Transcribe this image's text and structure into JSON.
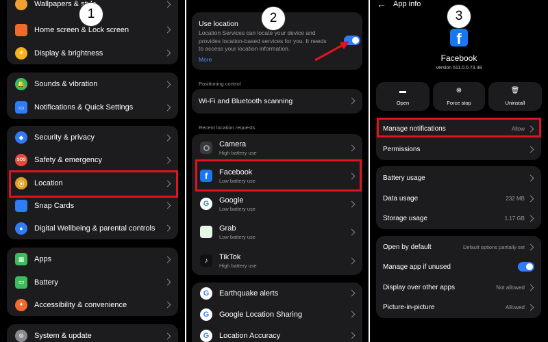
{
  "panel1": {
    "badge": "1",
    "items": [
      {
        "label": "Wallpapers & style",
        "color": "#f0a030"
      },
      {
        "label": "Home screen & Lock screen",
        "color": "#f06a2e"
      },
      {
        "label": "Display & brightness",
        "color": "#f6b21a"
      },
      {
        "label": "Sounds & vibration",
        "color": "#3cbc5a"
      },
      {
        "label": "Notifications & Quick Settings",
        "color": "#2f7cf6"
      },
      {
        "label": "Security & privacy",
        "color": "#2f7cf6"
      },
      {
        "label": "Safety & emergency",
        "color": "#e84a3c",
        "icon_text": "SOS"
      },
      {
        "label": "Location",
        "color": "#e0a020"
      },
      {
        "label": "Snap Cards",
        "color": "#2f7cf6"
      },
      {
        "label": "Digital Wellbeing & parental controls",
        "color": "#2f7cf6"
      },
      {
        "label": "Apps",
        "color": "#3cbc5a"
      },
      {
        "label": "Battery",
        "color": "#3cbc5a"
      },
      {
        "label": "Accessibility & convenience",
        "color": "#f06a2e"
      },
      {
        "label": "System & update",
        "color": "#8a8a8e"
      }
    ]
  },
  "panel2": {
    "badge": "2",
    "use_location": {
      "title": "Use location",
      "description": "Location Services can locate your device and provides location-based services for you. It needs to access your location information.",
      "more": "More",
      "enabled": true
    },
    "positioning_header": "Positioning control",
    "wifi_bt": "Wi-Fi and Bluetooth scanning",
    "recent_header": "Recent location requests",
    "recent": [
      {
        "name": "Camera",
        "usage": "High battery use"
      },
      {
        "name": "Facebook",
        "usage": "Low battery use"
      },
      {
        "name": "Google",
        "usage": "Low battery use"
      },
      {
        "name": "Grab",
        "usage": "Low battery use"
      },
      {
        "name": "TikTok",
        "usage": "High battery use"
      }
    ],
    "services": [
      {
        "name": "Earthquake alerts"
      },
      {
        "name": "Google Location Sharing"
      },
      {
        "name": "Location Accuracy"
      }
    ]
  },
  "panel3": {
    "badge": "3",
    "header": "App info",
    "app_name": "Facebook",
    "version": "version 511.0.0.73.38",
    "actions": {
      "open": "Open",
      "force_stop": "Force stop",
      "uninstall": "Uninstall"
    },
    "manage_notifications": {
      "label": "Manage notifications",
      "value": "Allow"
    },
    "permissions": "Permissions",
    "battery_usage": "Battery usage",
    "data_usage": {
      "label": "Data usage",
      "value": "232 MB"
    },
    "storage_usage": {
      "label": "Storage usage",
      "value": "1.17 GB"
    },
    "open_by_default": {
      "label": "Open by default",
      "value": "Default options partially set"
    },
    "manage_unused": {
      "label": "Manage app if unused",
      "enabled": true
    },
    "display_over": {
      "label": "Display over other apps",
      "value": "Not allowed"
    },
    "pip": {
      "label": "Picture-in-picture",
      "value": "Allowed"
    }
  },
  "colors": {
    "highlight": "#e0141e",
    "accent": "#2f7cf6",
    "facebook": "#1877f2"
  }
}
